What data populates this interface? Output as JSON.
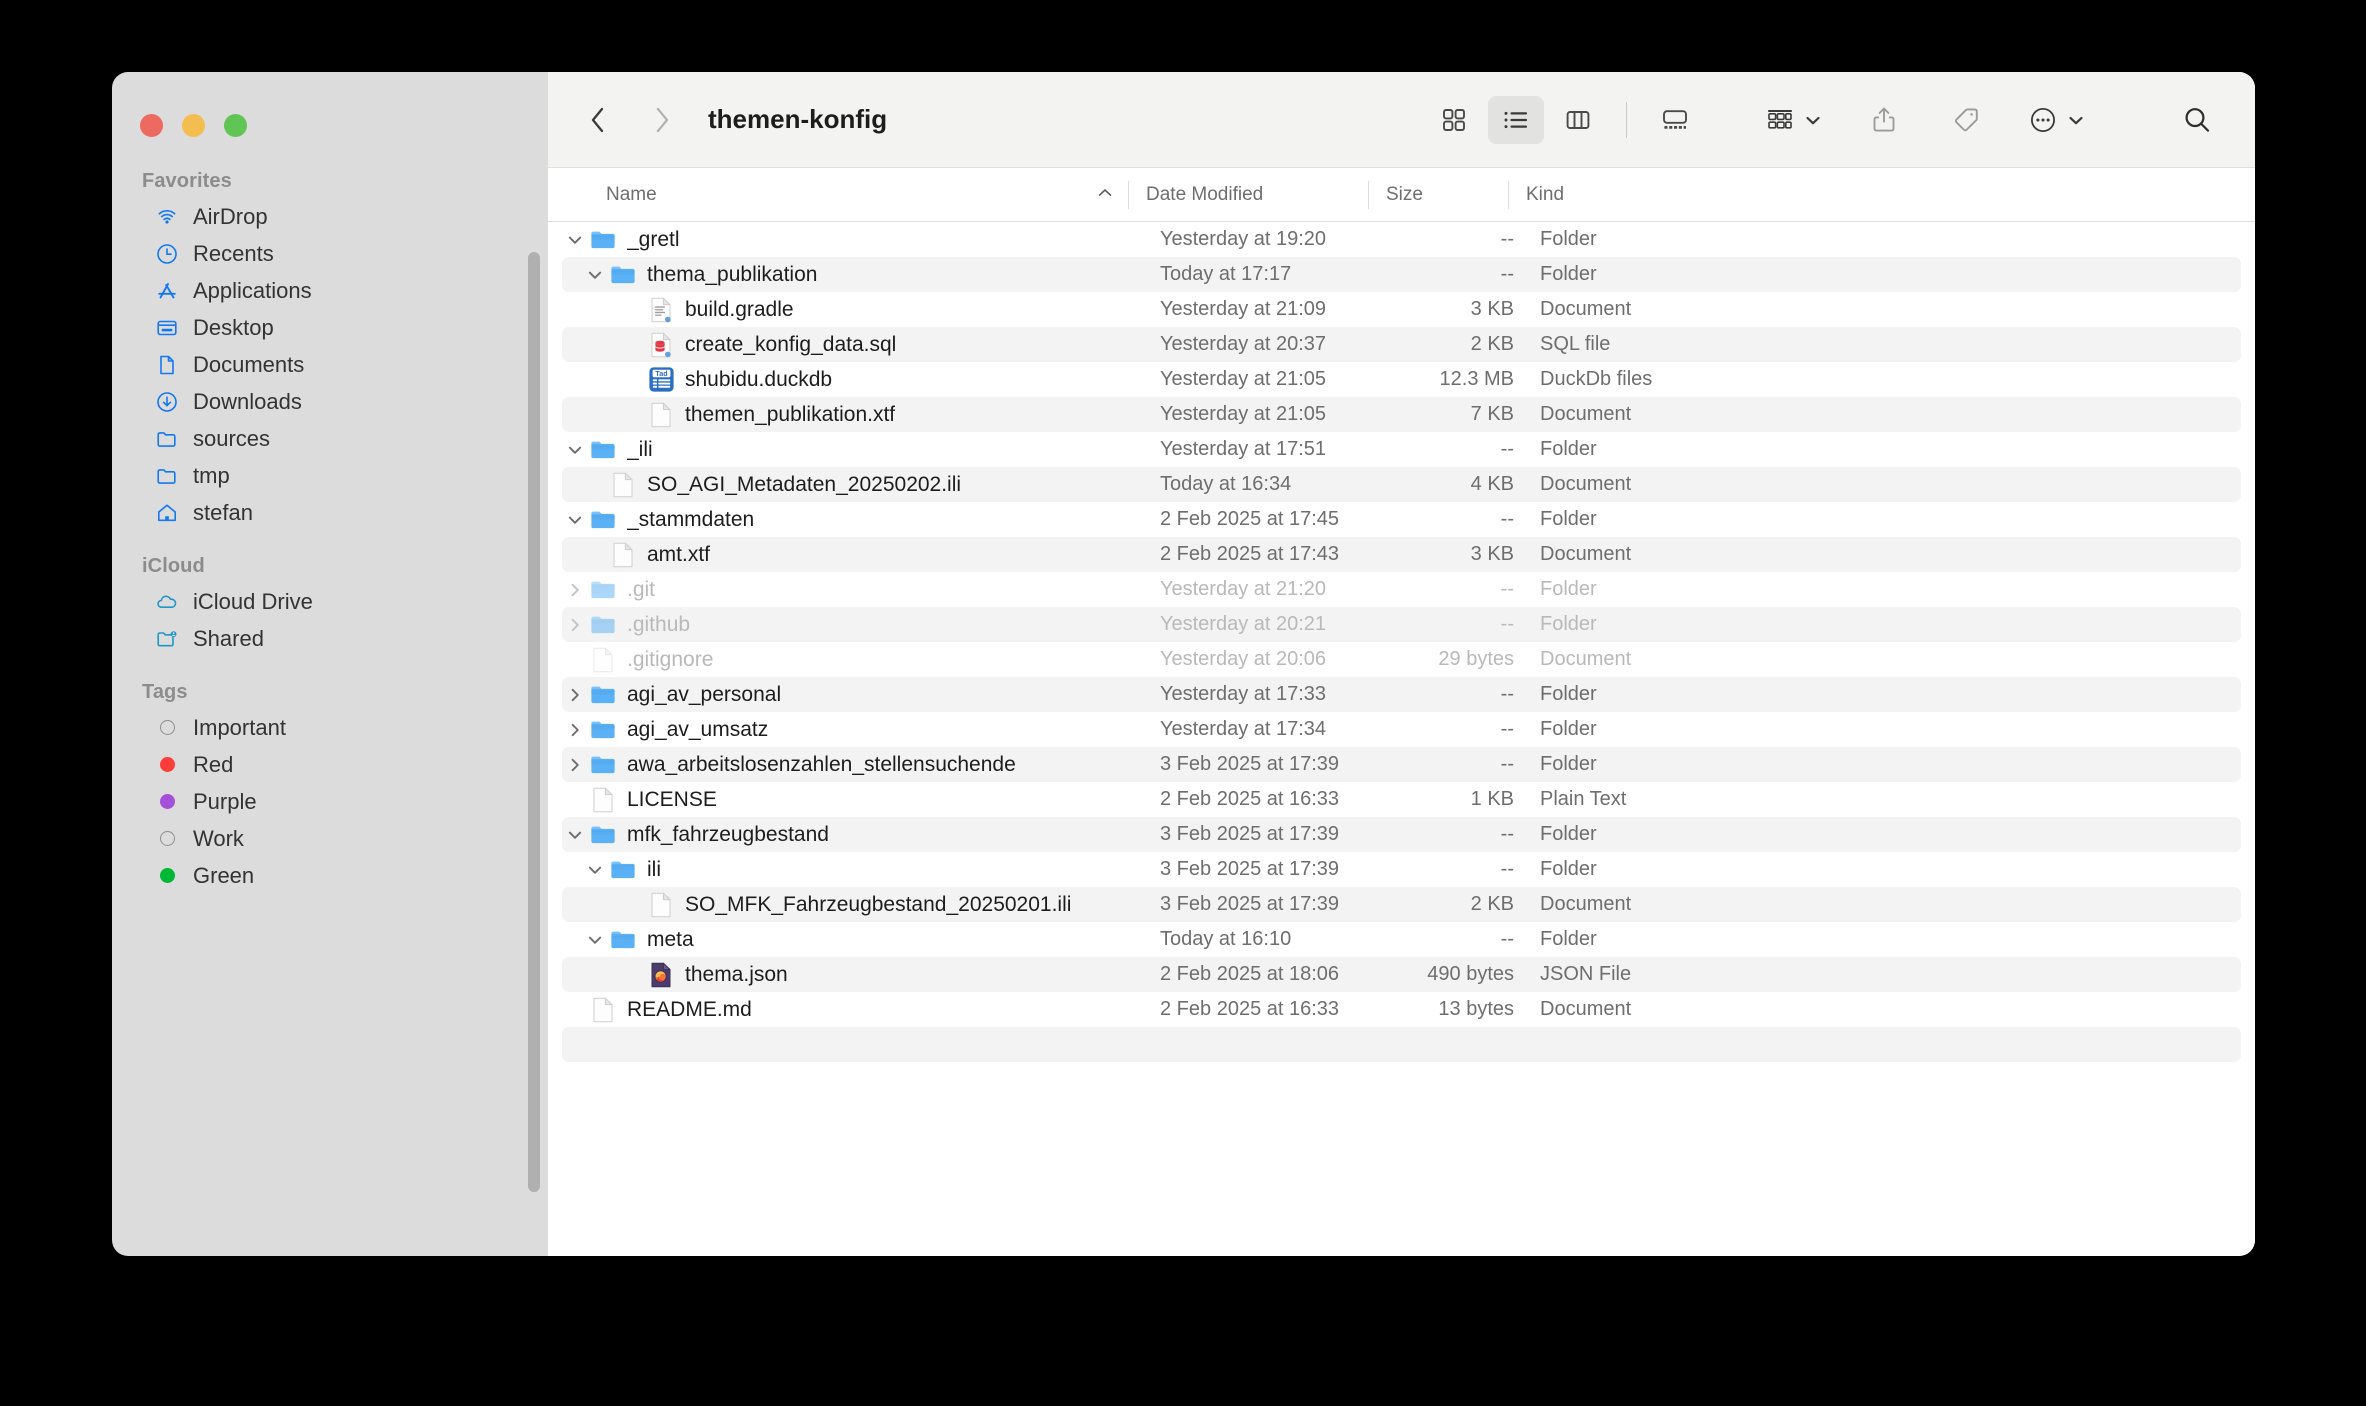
{
  "window": {
    "title": "themen-konfig",
    "traffic_lights": [
      {
        "name": "close",
        "color": "#ec6a5f"
      },
      {
        "name": "minimize",
        "color": "#f4bd4f"
      },
      {
        "name": "maximize",
        "color": "#61c555"
      }
    ]
  },
  "toolbar": {
    "back_icon": "chevron-left-icon",
    "forward_icon": "chevron-right-icon",
    "view_icon_grid": "icon-view-icon",
    "view_icon_list": "list-view-icon",
    "view_icon_column": "column-view-icon",
    "view_icon_gallery": "gallery-view-icon",
    "group_icon": "group-by-icon",
    "share_icon": "share-icon",
    "tag_icon": "tag-icon",
    "more_icon": "more-actions-icon",
    "search_icon": "search-icon",
    "active_view": "list-view-icon"
  },
  "sidebar": {
    "groups": [
      {
        "title": "Favorites",
        "items": [
          {
            "label": "AirDrop",
            "icon": "airdrop-icon"
          },
          {
            "label": "Recents",
            "icon": "clock-icon"
          },
          {
            "label": "Applications",
            "icon": "applications-icon"
          },
          {
            "label": "Desktop",
            "icon": "desktop-icon"
          },
          {
            "label": "Documents",
            "icon": "document-icon"
          },
          {
            "label": "Downloads",
            "icon": "download-icon"
          },
          {
            "label": "sources",
            "icon": "folder-icon"
          },
          {
            "label": "tmp",
            "icon": "folder-icon"
          },
          {
            "label": "stefan",
            "icon": "home-icon"
          }
        ]
      },
      {
        "title": "iCloud",
        "items": [
          {
            "label": "iCloud Drive",
            "icon": "cloud-icon"
          },
          {
            "label": "Shared",
            "icon": "shared-folder-icon"
          }
        ]
      },
      {
        "title": "Tags",
        "items": [
          {
            "label": "Important",
            "icon": "tag-dot-icon",
            "color": "none"
          },
          {
            "label": "Red",
            "icon": "tag-dot-icon",
            "color": "#fc3d39"
          },
          {
            "label": "Purple",
            "icon": "tag-dot-icon",
            "color": "#a550d8"
          },
          {
            "label": "Work",
            "icon": "tag-dot-icon",
            "color": "none"
          },
          {
            "label": "Green",
            "icon": "tag-dot-icon",
            "color": "#00b833"
          }
        ]
      }
    ]
  },
  "columns": {
    "name": "Name",
    "date_modified": "Date Modified",
    "size": "Size",
    "kind": "Kind",
    "sort_caret": "˄"
  },
  "files": [
    {
      "name": "_gretl",
      "date": "Yesterday at 19:20",
      "size": "--",
      "kind": "Folder",
      "icon": "folder-icon",
      "indent": 0,
      "twisty": "down",
      "dim": false
    },
    {
      "name": "thema_publikation",
      "date": "Today at 17:17",
      "size": "--",
      "kind": "Folder",
      "icon": "folder-icon",
      "indent": 1,
      "twisty": "down",
      "dim": false
    },
    {
      "name": "build.gradle",
      "date": "Yesterday at 21:09",
      "size": "3 KB",
      "kind": "Document",
      "icon": "gradle-document-icon",
      "indent": 2,
      "twisty": "none",
      "dim": false
    },
    {
      "name": "create_konfig_data.sql",
      "date": "Yesterday at 20:37",
      "size": "2 KB",
      "kind": "SQL file",
      "icon": "sql-document-icon",
      "indent": 2,
      "twisty": "none",
      "dim": false
    },
    {
      "name": "shubidu.duckdb",
      "date": "Yesterday at 21:05",
      "size": "12.3 MB",
      "kind": "DuckDb files",
      "icon": "tad-app-icon",
      "indent": 2,
      "twisty": "none",
      "dim": false
    },
    {
      "name": "themen_publikation.xtf",
      "date": "Yesterday at 21:05",
      "size": "7 KB",
      "kind": "Document",
      "icon": "blank-document-icon",
      "indent": 2,
      "twisty": "none",
      "dim": false
    },
    {
      "name": "_ili",
      "date": "Yesterday at 17:51",
      "size": "--",
      "kind": "Folder",
      "icon": "folder-icon",
      "indent": 0,
      "twisty": "down",
      "dim": false
    },
    {
      "name": "SO_AGI_Metadaten_20250202.ili",
      "date": "Today at 16:34",
      "size": "4 KB",
      "kind": "Document",
      "icon": "blank-document-icon",
      "indent": 1,
      "twisty": "none",
      "dim": false
    },
    {
      "name": "_stammdaten",
      "date": "2 Feb 2025 at 17:45",
      "size": "--",
      "kind": "Folder",
      "icon": "folder-icon",
      "indent": 0,
      "twisty": "down",
      "dim": false
    },
    {
      "name": "amt.xtf",
      "date": "2 Feb 2025 at 17:43",
      "size": "3 KB",
      "kind": "Document",
      "icon": "blank-document-icon",
      "indent": 1,
      "twisty": "none",
      "dim": false
    },
    {
      "name": ".git",
      "date": "Yesterday at 21:20",
      "size": "--",
      "kind": "Folder",
      "icon": "folder-icon",
      "indent": 0,
      "twisty": "right",
      "dim": true
    },
    {
      "name": ".github",
      "date": "Yesterday at 20:21",
      "size": "--",
      "kind": "Folder",
      "icon": "folder-icon",
      "indent": 0,
      "twisty": "right",
      "dim": true
    },
    {
      "name": ".gitignore",
      "date": "Yesterday at 20:06",
      "size": "29 bytes",
      "kind": "Document",
      "icon": "blank-document-icon",
      "indent": 0,
      "twisty": "none",
      "dim": true
    },
    {
      "name": "agi_av_personal",
      "date": "Yesterday at 17:33",
      "size": "--",
      "kind": "Folder",
      "icon": "folder-icon",
      "indent": 0,
      "twisty": "right",
      "dim": false
    },
    {
      "name": "agi_av_umsatz",
      "date": "Yesterday at 17:34",
      "size": "--",
      "kind": "Folder",
      "icon": "folder-icon",
      "indent": 0,
      "twisty": "right",
      "dim": false
    },
    {
      "name": "awa_arbeitslosenzahlen_stellensuchende",
      "date": "3 Feb 2025 at 17:39",
      "size": "--",
      "kind": "Folder",
      "icon": "folder-icon",
      "indent": 0,
      "twisty": "right",
      "dim": false
    },
    {
      "name": "LICENSE",
      "date": "2 Feb 2025 at 16:33",
      "size": "1 KB",
      "kind": "Plain Text",
      "icon": "blank-document-icon",
      "indent": 0,
      "twisty": "none",
      "dim": false
    },
    {
      "name": "mfk_fahrzeugbestand",
      "date": "3 Feb 2025 at 17:39",
      "size": "--",
      "kind": "Folder",
      "icon": "folder-icon",
      "indent": 0,
      "twisty": "down",
      "dim": false
    },
    {
      "name": "ili",
      "date": "3 Feb 2025 at 17:39",
      "size": "--",
      "kind": "Folder",
      "icon": "folder-icon",
      "indent": 1,
      "twisty": "down",
      "dim": false
    },
    {
      "name": "SO_MFK_Fahrzeugbestand_20250201.ili",
      "date": "3 Feb 2025 at 17:39",
      "size": "2 KB",
      "kind": "Document",
      "icon": "blank-document-icon",
      "indent": 2,
      "twisty": "none",
      "dim": false
    },
    {
      "name": "meta",
      "date": "Today at 16:10",
      "size": "--",
      "kind": "Folder",
      "icon": "folder-icon",
      "indent": 1,
      "twisty": "down",
      "dim": false
    },
    {
      "name": "thema.json",
      "date": "2 Feb 2025 at 18:06",
      "size": "490 bytes",
      "kind": "JSON File",
      "icon": "firefox-document-icon",
      "indent": 2,
      "twisty": "none",
      "dim": false
    },
    {
      "name": "README.md",
      "date": "2 Feb 2025 at 16:33",
      "size": "13 bytes",
      "kind": "Document",
      "icon": "blank-document-icon",
      "indent": 0,
      "twisty": "none",
      "dim": false
    }
  ]
}
